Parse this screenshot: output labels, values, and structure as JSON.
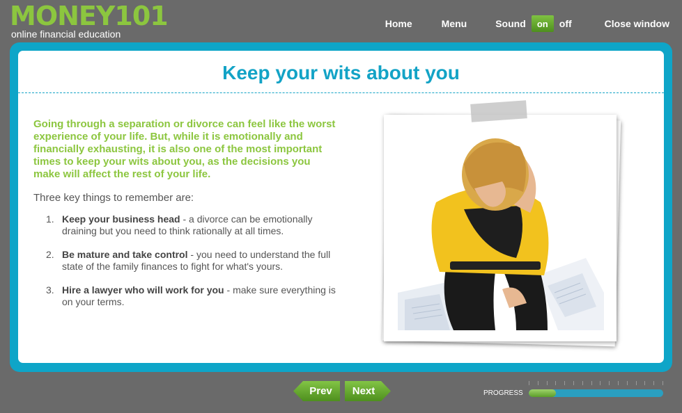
{
  "header": {
    "logo_text": "MONEY101",
    "logo_sub": "online financial education",
    "nav": {
      "home": "Home",
      "menu": "Menu",
      "sound_label": "Sound",
      "sound_on": "on",
      "sound_off": "off",
      "close": "Close window"
    }
  },
  "page": {
    "title": "Keep your wits about you",
    "intro": "Going through a separation or divorce can feel like the worst experience of your life. But, while it is emotionally and financially exhausting, it is also one of the most important times to keep your wits about you, as the decisions you make will affect the rest of your life.",
    "keys_intro": "Three key things to remember are:",
    "keys": [
      {
        "num": "1.",
        "bold": "Keep your business head",
        "text": " - a divorce can be emotionally draining but you need to think rationally at all times."
      },
      {
        "num": "2.",
        "bold": "Be mature and take control",
        "text": " - you need to understand the full state of the family finances to fight for what's yours."
      },
      {
        "num": "3.",
        "bold": "Hire a lawyer who will work for you",
        "text": " - make sure everything is on your terms."
      }
    ]
  },
  "footer": {
    "prev": "Prev",
    "next": "Next",
    "progress_label": "PROGRESS",
    "progress_fraction": 0.2
  },
  "colors": {
    "brand_green": "#8cc63f",
    "accent_blue": "#0ea5c8",
    "background": "#6a6a6a"
  },
  "icons": {
    "photo": "woman-stressed-photo"
  }
}
